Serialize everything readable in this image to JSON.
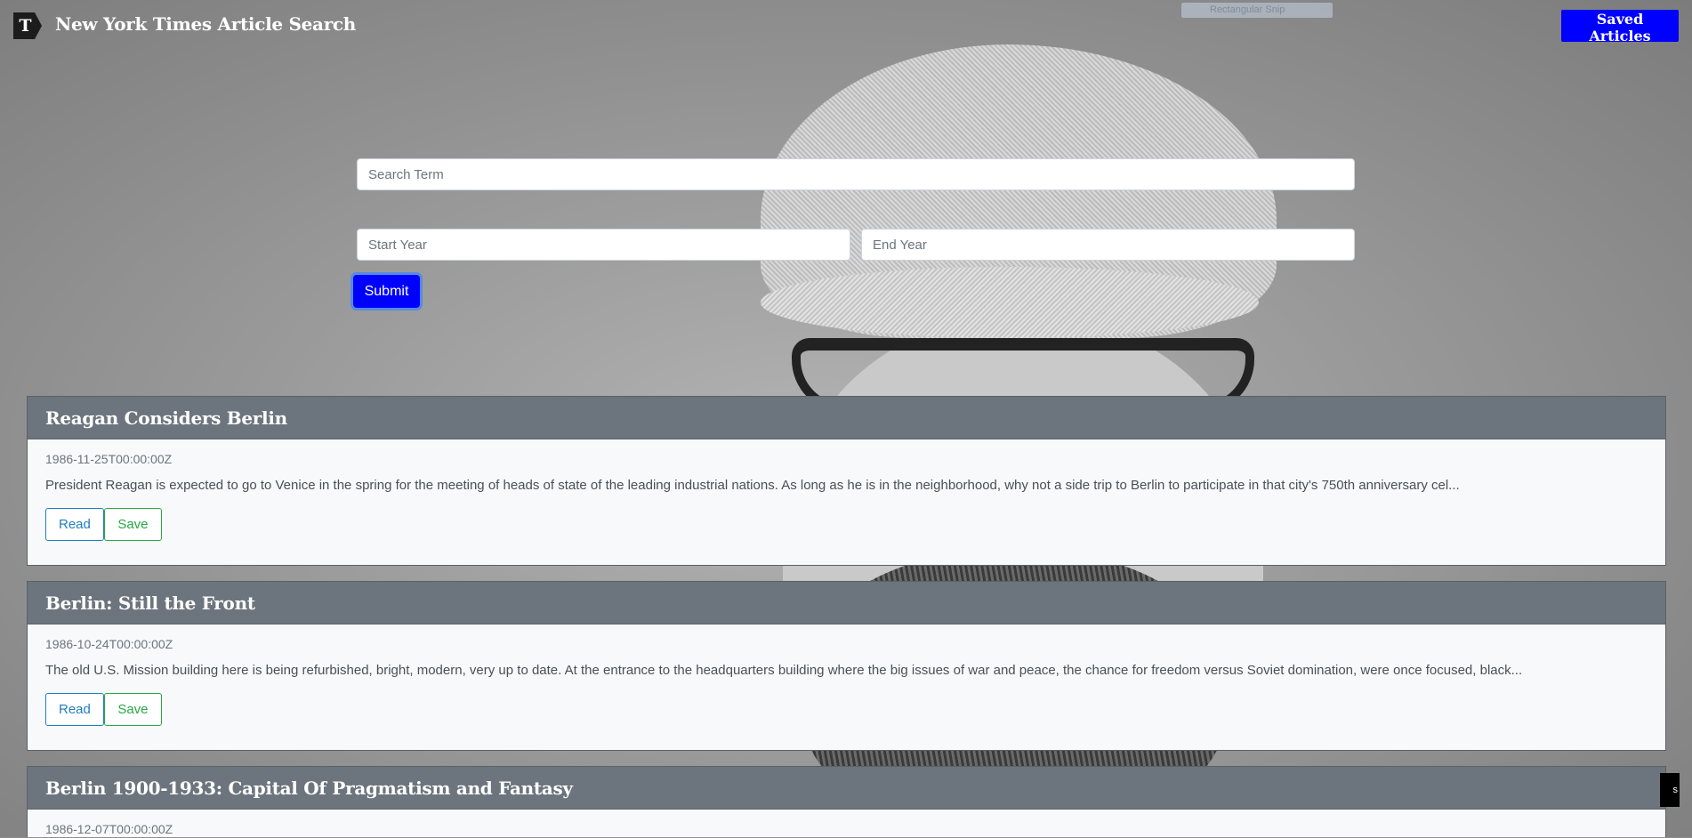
{
  "app": {
    "title": "New York Times Article Search",
    "logo_letter": "T"
  },
  "nav": {
    "saved_label": "Saved Articles"
  },
  "background": {
    "ghost_label": "Rectangular Snip"
  },
  "search": {
    "term_placeholder": "Search Term",
    "start_placeholder": "Start Year",
    "end_placeholder": "End Year",
    "submit_label": "Submit"
  },
  "articles": [
    {
      "title": "Reagan Considers Berlin",
      "date": "1986-11-25T00:00:00Z",
      "snippet": "President Reagan is expected to go to Venice in the spring for the meeting of heads of state of the leading industrial nations. As long as he is in the neighborhood, why not a side trip to Berlin to participate in that city's 750th anniversary cel...",
      "read_label": "Read",
      "save_label": "Save"
    },
    {
      "title": "Berlin: Still the Front",
      "date": "1986-10-24T00:00:00Z",
      "snippet": "The old U.S. Mission building here is being refurbished, bright, modern, very up to date. At the entrance to the headquarters building where the big issues of war and peace, the chance for freedom versus Soviet domination, were once focused, black...",
      "read_label": "Read",
      "save_label": "Save"
    },
    {
      "title": "Berlin 1900-1933: Capital Of Pragmatism and Fantasy",
      "date": "1986-12-07T00:00:00Z"
    }
  ],
  "corner": {
    "text": "s"
  },
  "colors": {
    "primary": "#0000ff",
    "card_header": "#6c757d",
    "read": "#1f7ec1",
    "save": "#28a745"
  }
}
